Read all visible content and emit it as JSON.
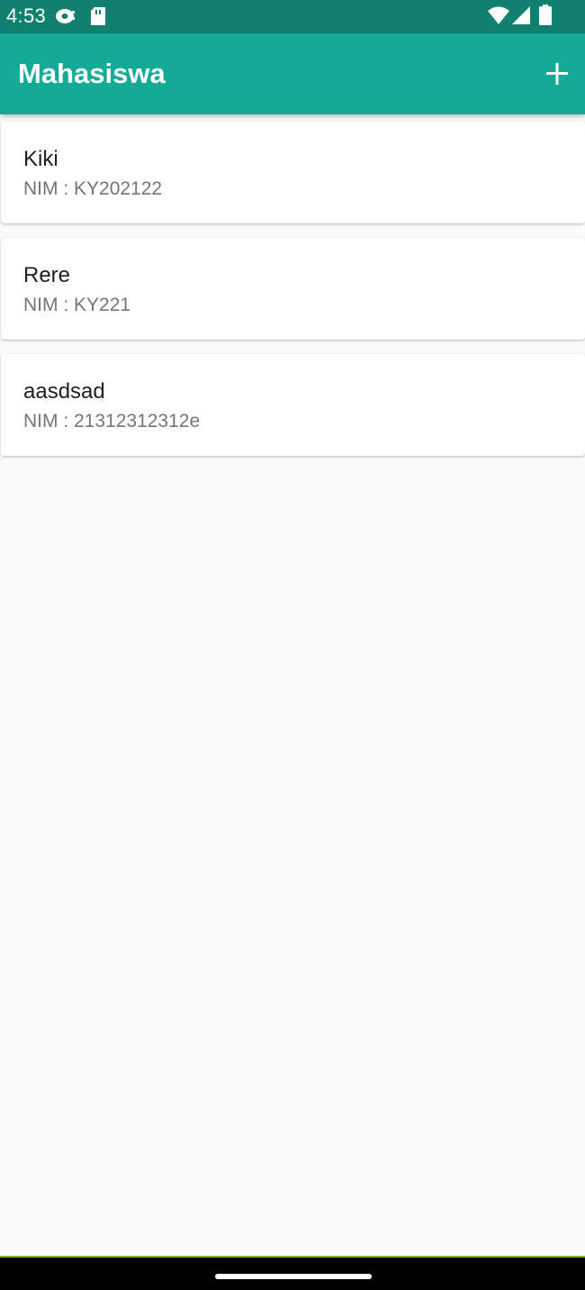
{
  "status_bar": {
    "time": "4:53",
    "left_icons": [
      "cast-icon",
      "sd-card-icon"
    ],
    "right_icons": [
      "wifi-icon",
      "cell-signal-icon",
      "battery-icon"
    ]
  },
  "app_bar": {
    "title": "Mahasiswa",
    "action_icon": "add-icon"
  },
  "students": [
    {
      "name": "Kiki",
      "nim": "NIM : KY202122"
    },
    {
      "name": "Rere",
      "nim": "NIM : KY221"
    },
    {
      "name": "aasdsad",
      "nim": "NIM : 21312312312e"
    }
  ],
  "colors": {
    "status_bar": "#10806f",
    "app_bar": "#13ab96",
    "background": "#fafafa",
    "card": "#ffffff",
    "name_text": "#212121",
    "nim_text": "#757575"
  }
}
